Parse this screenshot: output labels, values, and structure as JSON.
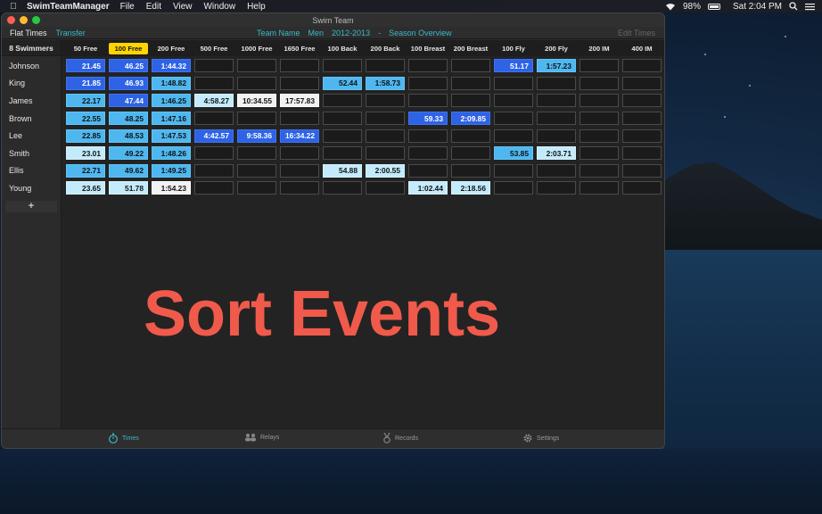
{
  "menubar": {
    "app_name": "SwimTeamManager",
    "menus": [
      "File",
      "Edit",
      "View",
      "Window",
      "Help"
    ],
    "battery": "98%",
    "clock": "Sat 2:04 PM"
  },
  "window": {
    "title": "Swim Team",
    "toolbar": {
      "flat_times": "Flat Times",
      "transfer": "Transfer",
      "team_name": "Team Name",
      "gender": "Men",
      "season": "2012-2013",
      "separator": "-",
      "view": "Season Overview",
      "edit_times": "Edit Times"
    }
  },
  "sidebar": {
    "header": "8 Swimmers",
    "swimmers": [
      "Johnson",
      "King",
      "James",
      "Brown",
      "Lee",
      "Smith",
      "Ellis",
      "Young"
    ],
    "add": "+"
  },
  "events": [
    "50 Free",
    "100 Free",
    "200 Free",
    "500 Free",
    "1000 Free",
    "1650 Free",
    "100 Back",
    "200 Back",
    "100 Breast",
    "200 Breast",
    "100 Fly",
    "200 Fly",
    "200 IM",
    "400 IM"
  ],
  "selected_event": "100 Free",
  "times": [
    [
      [
        "21.45",
        "c1"
      ],
      [
        "46.25",
        "c1"
      ],
      [
        "1:44.32",
        "c1"
      ],
      [
        "",
        ""
      ],
      [
        "",
        ""
      ],
      [
        "",
        ""
      ],
      [
        "",
        ""
      ],
      [
        "",
        ""
      ],
      [
        "",
        ""
      ],
      [
        "",
        ""
      ],
      [
        "51.17",
        "c1"
      ],
      [
        "1:57.23",
        "c2"
      ],
      [
        "",
        ""
      ],
      [
        "",
        ""
      ]
    ],
    [
      [
        "21.85",
        "c1"
      ],
      [
        "46.93",
        "c1"
      ],
      [
        "1:48.82",
        "c2"
      ],
      [
        "",
        ""
      ],
      [
        "",
        ""
      ],
      [
        "",
        ""
      ],
      [
        "52.44",
        "c2"
      ],
      [
        "1:58.73",
        "c2"
      ],
      [
        "",
        ""
      ],
      [
        "",
        ""
      ],
      [
        "",
        ""
      ],
      [
        "",
        ""
      ],
      [
        "",
        ""
      ],
      [
        "",
        ""
      ]
    ],
    [
      [
        "22.17",
        "c2"
      ],
      [
        "47.44",
        "c1"
      ],
      [
        "1:46.25",
        "c2"
      ],
      [
        "4:58.27",
        "c3"
      ],
      [
        "10:34.55",
        "c4"
      ],
      [
        "17:57.83",
        "c4"
      ],
      [
        "",
        ""
      ],
      [
        "",
        ""
      ],
      [
        "",
        ""
      ],
      [
        "",
        ""
      ],
      [
        "",
        ""
      ],
      [
        "",
        ""
      ],
      [
        "",
        ""
      ],
      [
        "",
        ""
      ]
    ],
    [
      [
        "22.55",
        "c2"
      ],
      [
        "48.25",
        "c2"
      ],
      [
        "1:47.16",
        "c2"
      ],
      [
        "",
        ""
      ],
      [
        "",
        ""
      ],
      [
        "",
        ""
      ],
      [
        "",
        ""
      ],
      [
        "",
        ""
      ],
      [
        "59.33",
        "c1"
      ],
      [
        "2:09.85",
        "c1"
      ],
      [
        "",
        ""
      ],
      [
        "",
        ""
      ],
      [
        "",
        ""
      ],
      [
        "",
        ""
      ]
    ],
    [
      [
        "22.85",
        "c2"
      ],
      [
        "48.53",
        "c2"
      ],
      [
        "1:47.53",
        "c2"
      ],
      [
        "4:42.57",
        "c1"
      ],
      [
        "9:58.36",
        "c1"
      ],
      [
        "16:34.22",
        "c1"
      ],
      [
        "",
        ""
      ],
      [
        "",
        ""
      ],
      [
        "",
        ""
      ],
      [
        "",
        ""
      ],
      [
        "",
        ""
      ],
      [
        "",
        ""
      ],
      [
        "",
        ""
      ],
      [
        "",
        ""
      ]
    ],
    [
      [
        "23.01",
        "c3"
      ],
      [
        "49.22",
        "c2"
      ],
      [
        "1:48.26",
        "c2"
      ],
      [
        "",
        ""
      ],
      [
        "",
        ""
      ],
      [
        "",
        ""
      ],
      [
        "",
        ""
      ],
      [
        "",
        ""
      ],
      [
        "",
        ""
      ],
      [
        "",
        ""
      ],
      [
        "53.85",
        "c2"
      ],
      [
        "2:03.71",
        "c3"
      ],
      [
        "",
        ""
      ],
      [
        "",
        ""
      ]
    ],
    [
      [
        "22.71",
        "c2"
      ],
      [
        "49.62",
        "c2"
      ],
      [
        "1:49.25",
        "c2"
      ],
      [
        "",
        ""
      ],
      [
        "",
        ""
      ],
      [
        "",
        ""
      ],
      [
        "54.88",
        "c3"
      ],
      [
        "2:00.55",
        "c3"
      ],
      [
        "",
        ""
      ],
      [
        "",
        ""
      ],
      [
        "",
        ""
      ],
      [
        "",
        ""
      ],
      [
        "",
        ""
      ],
      [
        "",
        ""
      ]
    ],
    [
      [
        "23.65",
        "c3"
      ],
      [
        "51.78",
        "c3"
      ],
      [
        "1:54.23",
        "c4"
      ],
      [
        "",
        ""
      ],
      [
        "",
        ""
      ],
      [
        "",
        ""
      ],
      [
        "",
        ""
      ],
      [
        "",
        ""
      ],
      [
        "1:02.44",
        "c3"
      ],
      [
        "2:18.56",
        "c3"
      ],
      [
        "",
        ""
      ],
      [
        "",
        ""
      ],
      [
        "",
        ""
      ],
      [
        "",
        ""
      ]
    ]
  ],
  "overlay_text": "Sort Events",
  "tabs": [
    {
      "label": "Times",
      "icon": "stopwatch-icon",
      "active": true
    },
    {
      "label": "Relays",
      "icon": "people-icon",
      "active": false
    },
    {
      "label": "Records",
      "icon": "medal-icon",
      "active": false
    },
    {
      "label": "Settings",
      "icon": "gear-icon",
      "active": false
    }
  ],
  "colors": {
    "accent": "#3bb9c5",
    "highlight": "#ffd400",
    "overlay": "#f05a4b",
    "fast": "#2e63e6",
    "good": "#4fb7ef",
    "mid": "#c4ebfb",
    "slow": "#f2f2f2"
  }
}
